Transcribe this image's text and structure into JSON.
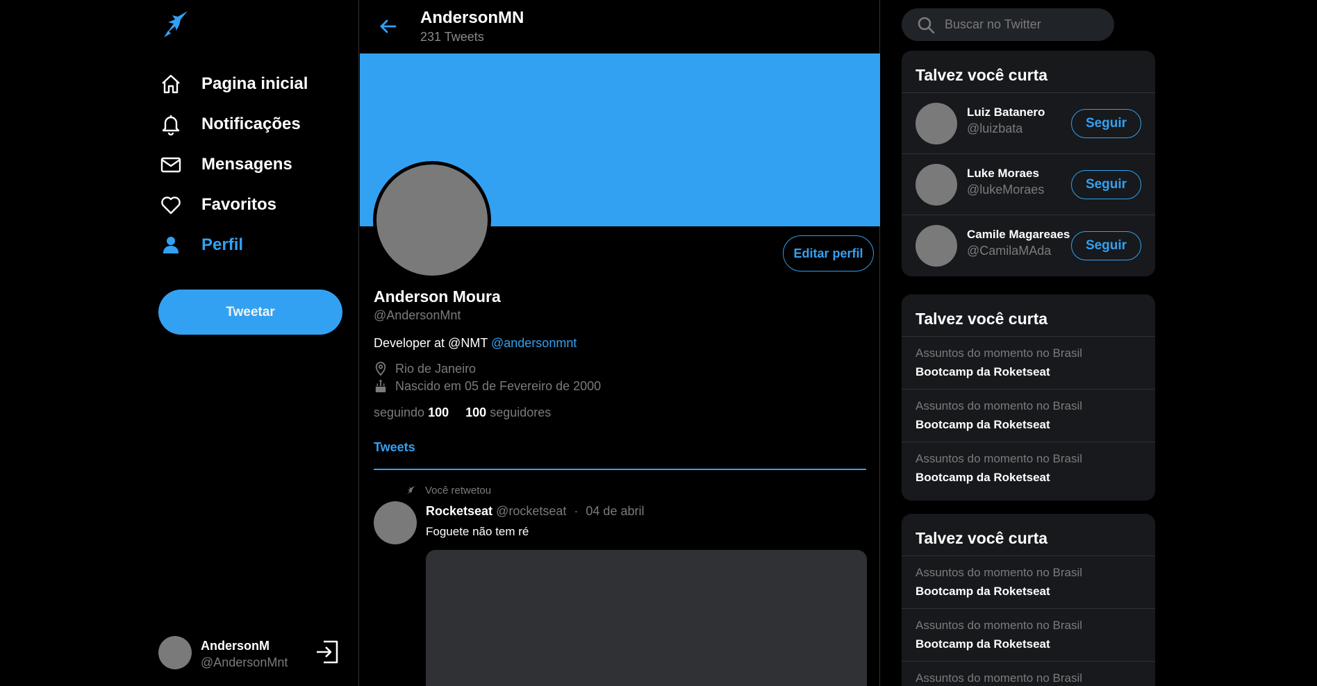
{
  "colors": {
    "accent": "#33a1f2",
    "background": "#000000",
    "panel": "#17191c",
    "muted": "#7b7b7b"
  },
  "sidebar": {
    "logo_icon": "rocket-bird-icon",
    "items": [
      {
        "label": "Pagina inicial",
        "icon": "home-icon"
      },
      {
        "label": "Notificações",
        "icon": "bell-icon"
      },
      {
        "label": "Mensagens",
        "icon": "mail-icon"
      },
      {
        "label": "Favoritos",
        "icon": "heart-icon"
      },
      {
        "label": "Perfil",
        "icon": "user-icon",
        "active": true
      }
    ],
    "tweet_button": "Tweetar",
    "user": {
      "name": "AndersonM",
      "handle": "@AndersonMnt",
      "exit_icon": "logout-icon"
    }
  },
  "header": {
    "name": "AndersonMN",
    "tweet_count": "231 Tweets"
  },
  "profile": {
    "edit_button": "Editar perfil",
    "name": "Anderson Moura",
    "handle": "@AndersonMnt",
    "bio_text": "Developer at @NMT ",
    "bio_link": "@andersonmnt",
    "location": "Rio de Janeiro",
    "birth": "Nascido em 05 de Fevereiro de 2000",
    "following_label": "seguindo",
    "following_count": "100",
    "followers_count": "100",
    "followers_label": "seguidores",
    "tab": "Tweets"
  },
  "tweet": {
    "retweet_label": "Você retwetou",
    "name": "Rocketseat",
    "handle": "@rocketseat",
    "separator": "·",
    "date": "04 de abril",
    "text": "Foguete não tem ré"
  },
  "search": {
    "placeholder": "Buscar no Twitter"
  },
  "who_to_follow": {
    "title": "Talvez você curta",
    "users": [
      {
        "name": "Luiz Batanero",
        "handle": "@luizbata",
        "button": "Seguir"
      },
      {
        "name": "Luke Moraes",
        "handle": "@lukeMoraes",
        "button": "Seguir"
      },
      {
        "name": "Camile Magareaes",
        "handle": "@CamilaMAda",
        "button": "Seguir"
      }
    ]
  },
  "trends_1": {
    "title": "Talvez você curta",
    "items": [
      {
        "context": "Assuntos do momento no Brasil",
        "topic": "Bootcamp da Roketseat"
      },
      {
        "context": "Assuntos do momento no Brasil",
        "topic": "Bootcamp da Roketseat"
      },
      {
        "context": "Assuntos do momento no Brasil",
        "topic": "Bootcamp da Roketseat"
      }
    ]
  },
  "trends_2": {
    "title": "Talvez você curta",
    "items": [
      {
        "context": "Assuntos do momento no Brasil",
        "topic": "Bootcamp da Roketseat"
      },
      {
        "context": "Assuntos do momento no Brasil",
        "topic": "Bootcamp da Roketseat"
      },
      {
        "context": "Assuntos do momento no Brasil",
        "topic": ""
      }
    ]
  }
}
